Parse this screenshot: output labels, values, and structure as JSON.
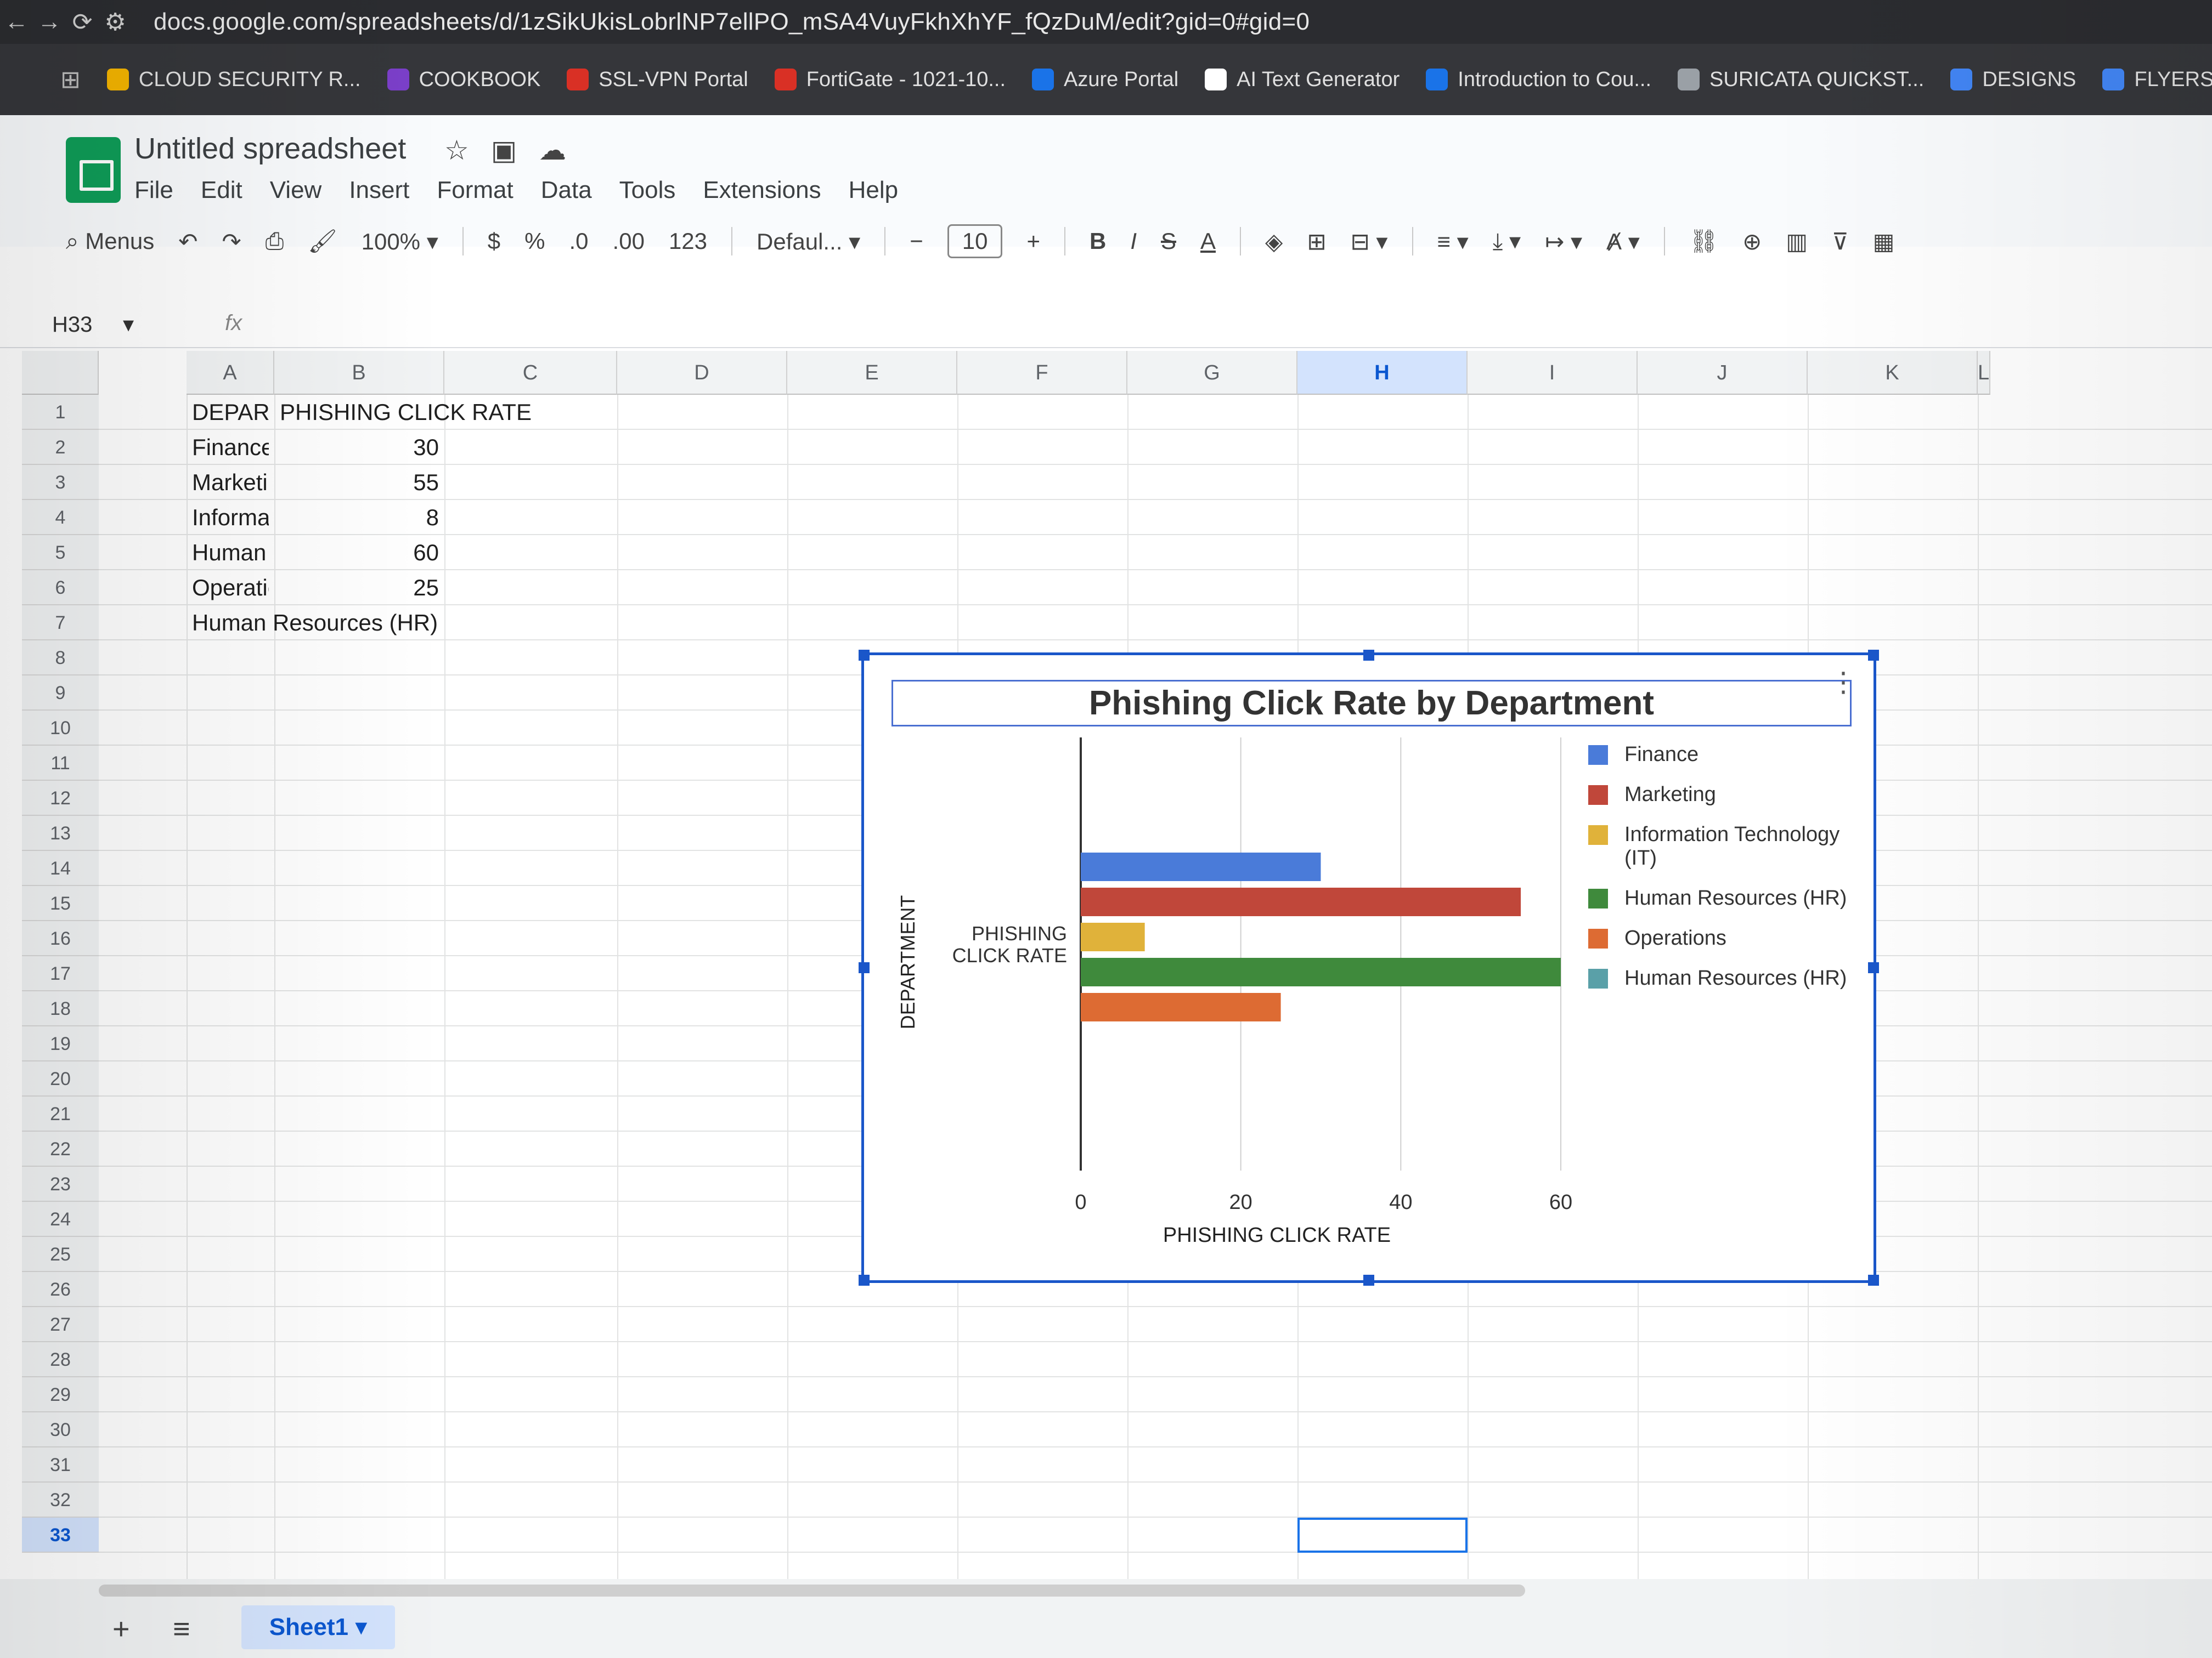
{
  "browser": {
    "url": "docs.google.com/spreadsheets/d/1zSikUkisLobrlNP7ellPO_mSA4VuyFkhXhYF_fQzDuM/edit?gid=0#gid=0",
    "bookmarks": [
      {
        "label": "CLOUD SECURITY R...",
        "color": "#f4b400"
      },
      {
        "label": "COOKBOOK",
        "color": "#7b3fc9"
      },
      {
        "label": "SSL-VPN Portal",
        "color": "#d93025"
      },
      {
        "label": "FortiGate - 1021-10...",
        "color": "#d93025"
      },
      {
        "label": "Azure Portal",
        "color": "#1a73e8"
      },
      {
        "label": "AI Text Generator",
        "color": "#ffffff"
      },
      {
        "label": "Introduction to Cou...",
        "color": "#1a73e8"
      },
      {
        "label": "SURICATA QUICKST...",
        "color": "#9aa0a6"
      },
      {
        "label": "DESIGNS",
        "color": "#4285f4"
      },
      {
        "label": "FLYERS",
        "color": "#4285f4"
      }
    ]
  },
  "sheets": {
    "title": "Untitled spreadsheet",
    "menu": [
      "File",
      "Edit",
      "View",
      "Insert",
      "Format",
      "Data",
      "Tools",
      "Extensions",
      "Help"
    ],
    "toolbar": {
      "search": "Menus",
      "zoom": "100%",
      "currency": "$",
      "percent": "%",
      "dec_decrease": ".0",
      "dec_increase": ".00",
      "format_123": "123",
      "font": "Defaul...",
      "font_size": "10",
      "bold": "B",
      "italic": "I"
    },
    "name_box": "H33",
    "fx": "fx",
    "columns": [
      "A",
      "B",
      "C",
      "D",
      "E",
      "F",
      "G",
      "H",
      "I",
      "J",
      "K",
      "L"
    ],
    "selected_column": "H",
    "rows": [
      "1",
      "2",
      "3",
      "4",
      "5",
      "6",
      "7",
      "8",
      "9",
      "10",
      "11",
      "12",
      "13",
      "14",
      "15",
      "16",
      "17",
      "18",
      "19",
      "20",
      "21",
      "22",
      "23",
      "24",
      "25",
      "26",
      "27",
      "28",
      "29",
      "30",
      "31",
      "32",
      "33"
    ],
    "selected_row": "33",
    "cells": {
      "A1": "DEPARTMENT",
      "B1": "PHISHING CLICK RATE",
      "A2": "Finance",
      "B2": "30",
      "A3": "Marketing",
      "B3": "55",
      "A4": "Information Tech",
      "B4": "8",
      "A5": "Human Resourc",
      "B5": "60",
      "A6": "Operations",
      "B6": "25",
      "A7": "Human Resources (HR)"
    },
    "sheet_tab": "Sheet1",
    "add_sheet": "+",
    "all_sheets": "≡"
  },
  "chart_data": {
    "type": "bar",
    "orientation": "horizontal",
    "title": "Phishing Click Rate by Department",
    "xlabel": "PHISHING CLICK RATE",
    "ylabel": "DEPARTMENT",
    "category_label": "PHISHING CLICK RATE",
    "xlim": [
      0,
      60
    ],
    "x_ticks": [
      "0",
      "20",
      "40",
      "60"
    ],
    "grid": true,
    "legend_position": "right",
    "series": [
      {
        "name": "Finance",
        "value": 30,
        "color": "#4a7bd9"
      },
      {
        "name": "Marketing",
        "value": 55,
        "color": "#c0473a"
      },
      {
        "name": "Information Technology (IT)",
        "value": 8,
        "color": "#e0b23a"
      },
      {
        "name": "Human Resources (HR)",
        "value": 60,
        "color": "#3f8a3c"
      },
      {
        "name": "Operations",
        "value": 25,
        "color": "#dd6b33"
      },
      {
        "name": "Human Resources (HR)",
        "value": 0,
        "color": "#5aa0a8"
      }
    ]
  }
}
